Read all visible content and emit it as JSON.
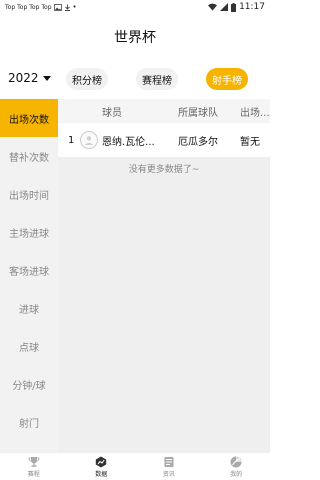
{
  "status_bar": {
    "notif_labels": [
      "Top",
      "Top",
      "Top",
      "Top"
    ],
    "time": "11:17"
  },
  "header": {
    "title": "世界杯"
  },
  "filters": {
    "year": "2022",
    "tabs": [
      {
        "label": "积分榜",
        "active": false
      },
      {
        "label": "赛程榜",
        "active": false
      },
      {
        "label": "射手榜",
        "active": true
      }
    ]
  },
  "sidebar": {
    "items": [
      {
        "label": "出场次数",
        "active": true
      },
      {
        "label": "替补次数",
        "active": false
      },
      {
        "label": "出场时间",
        "active": false
      },
      {
        "label": "主场进球",
        "active": false
      },
      {
        "label": "客场进球",
        "active": false
      },
      {
        "label": "进球",
        "active": false
      },
      {
        "label": "点球",
        "active": false
      },
      {
        "label": "分钟/球",
        "active": false
      },
      {
        "label": "射门",
        "active": false
      }
    ]
  },
  "table": {
    "headers": {
      "player": "球员",
      "team": "所属球队",
      "apps": "出场..."
    },
    "rows": [
      {
        "rank": "1",
        "player": "恩纳.瓦伦...",
        "team": "厄瓜多尔",
        "apps": "暂无"
      }
    ],
    "empty_note": "没有更多数据了~"
  },
  "tabbar": {
    "items": [
      {
        "label": "赛程",
        "icon": "trophy-icon",
        "active": false
      },
      {
        "label": "数据",
        "icon": "chart-icon",
        "active": true
      },
      {
        "label": "资讯",
        "icon": "news-icon",
        "active": false
      },
      {
        "label": "我的",
        "icon": "profile-icon",
        "active": false
      }
    ]
  },
  "colors": {
    "accent": "#f6b400",
    "sidebar_bg": "#f2f2f2",
    "inactive_text": "#888888"
  }
}
